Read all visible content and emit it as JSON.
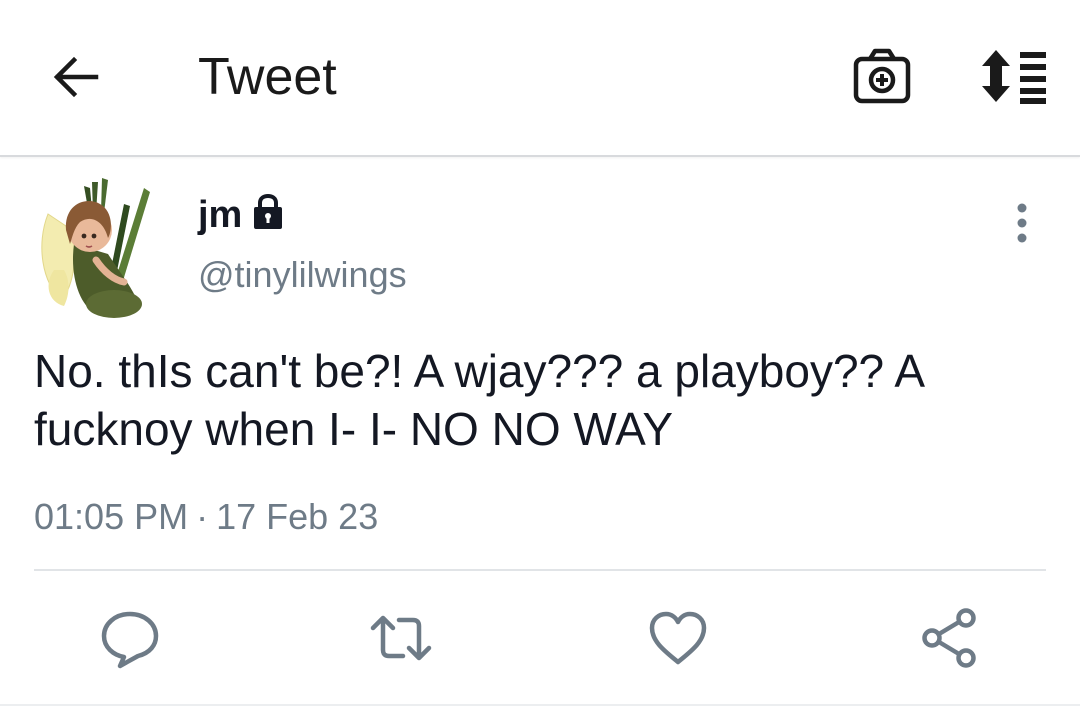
{
  "header": {
    "title": "Tweet",
    "back_icon": "arrow-left-icon",
    "camera_icon": "camera-plus-icon",
    "sort_icon": "sort-list-icon"
  },
  "author": {
    "display_name": "jm",
    "handle": "@tinylilwings",
    "protected_icon": "lock-icon",
    "avatar_description_icon": "fairy-avatar-image"
  },
  "tweet": {
    "text": "No. thIs can't be?! A wjay??? a playboy?? A\nfucknoy when I- I- NO NO WAY",
    "time": "01:05 PM",
    "separator": "·",
    "date": "17 Feb 23"
  },
  "actions": {
    "reply_icon": "reply-icon",
    "retweet_icon": "retweet-icon",
    "like_icon": "heart-icon",
    "share_icon": "share-icon",
    "more_icon": "more-vertical-icon"
  },
  "colors": {
    "text_primary": "#141823",
    "text_secondary": "#6e7b87",
    "icon_gray": "#6e7b87",
    "divider": "#e1e4e7",
    "background": "#ffffff"
  }
}
